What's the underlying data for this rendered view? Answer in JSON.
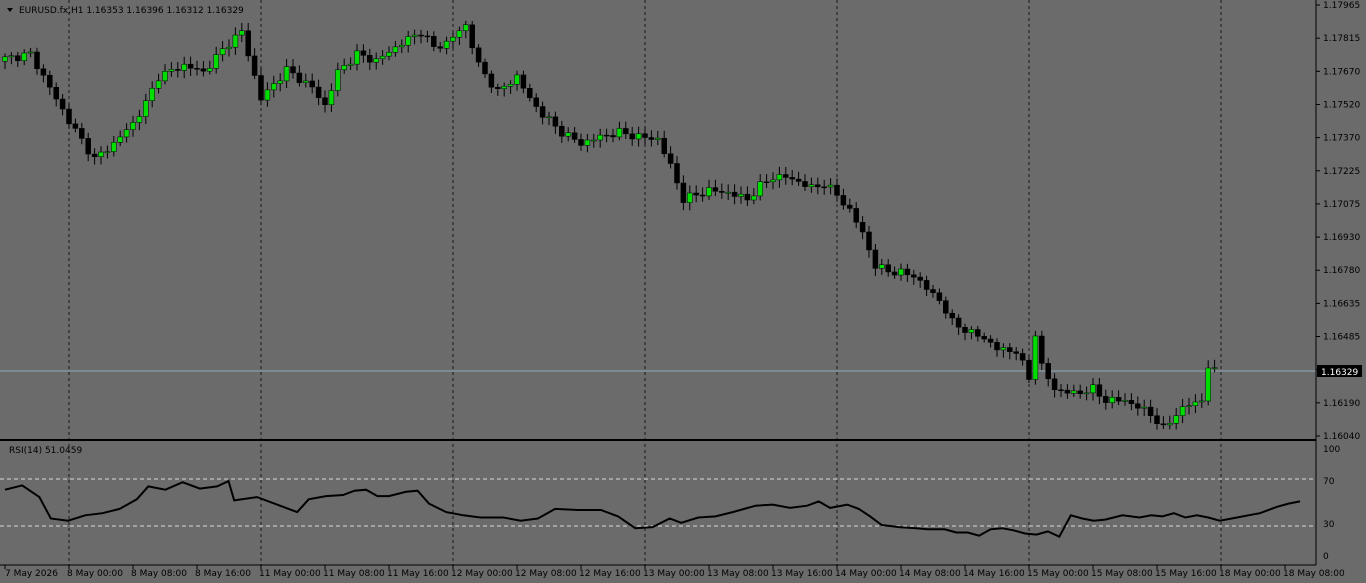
{
  "header": {
    "symbol_line": "EURUSD.fx,H1  1.16353 1.16396 1.16312 1.16329"
  },
  "indicator": {
    "label": "RSI(14) 51.0459",
    "levels": [
      "100",
      "70",
      "30",
      "0"
    ]
  },
  "colors": {
    "background": "#6b6b6b",
    "bull_candle": "#00dd00",
    "bear_candle": "#000000",
    "grid_separator": "#1a1a1a",
    "price_line": "#8fa8b8",
    "rsi_line": "#000000",
    "rsi_levels": "#d9d9d9"
  },
  "chart_data": [
    {
      "type": "candlestick",
      "symbol": "EURUSD.fx",
      "timeframe": "H1",
      "current_price": "1.16329",
      "ylim": [
        1.1604,
        1.1797
      ],
      "price_ticks": [
        "1.17965",
        "1.17815",
        "1.17670",
        "1.17520",
        "1.17370",
        "1.17225",
        "1.17075",
        "1.16930",
        "1.16780",
        "1.16635",
        "1.16485",
        "1.16335",
        "1.16190",
        "1.16040"
      ],
      "time_labels": [
        "7 May 2026",
        "8 May 00:00",
        "8 May 08:00",
        "8 May 16:00",
        "11 May 00:00",
        "11 May 08:00",
        "11 May 16:00",
        "12 May 00:00",
        "12 May 08:00",
        "12 May 16:00",
        "13 May 00:00",
        "13 May 08:00",
        "13 May 16:00",
        "14 May 00:00",
        "14 May 08:00",
        "14 May 16:00",
        "15 May 00:00",
        "15 May 08:00",
        "15 May 16:00",
        "18 May 00:00",
        "18 May 08:00"
      ],
      "close_path": [
        [
          0,
          1.1773
        ],
        [
          4,
          1.1775
        ],
        [
          8,
          1.1755
        ],
        [
          10,
          1.1745
        ],
        [
          14,
          1.1728
        ],
        [
          17,
          1.1735
        ],
        [
          20,
          1.1744
        ],
        [
          22,
          1.1753
        ],
        [
          24,
          1.1765
        ],
        [
          28,
          1.177
        ],
        [
          31,
          1.1767
        ],
        [
          35,
          1.178
        ],
        [
          37,
          1.1785
        ],
        [
          40,
          1.1755
        ],
        [
          44,
          1.1768
        ],
        [
          48,
          1.176
        ],
        [
          50,
          1.1752
        ],
        [
          52,
          1.1767
        ],
        [
          55,
          1.1775
        ],
        [
          58,
          1.1772
        ],
        [
          62,
          1.178
        ],
        [
          65,
          1.1785
        ],
        [
          67,
          1.1778
        ],
        [
          69,
          1.178
        ],
        [
          72,
          1.1788
        ],
        [
          74,
          1.177
        ],
        [
          77,
          1.1758
        ],
        [
          80,
          1.1765
        ],
        [
          82,
          1.1755
        ],
        [
          84,
          1.1748
        ],
        [
          87,
          1.174
        ],
        [
          90,
          1.1735
        ],
        [
          93,
          1.1738
        ],
        [
          96,
          1.174
        ],
        [
          99,
          1.1738
        ],
        [
          102,
          1.1737
        ],
        [
          104,
          1.1725
        ],
        [
          106,
          1.171
        ],
        [
          110,
          1.1714
        ],
        [
          113,
          1.1713
        ],
        [
          116,
          1.171
        ],
        [
          118,
          1.1716
        ],
        [
          120,
          1.172
        ],
        [
          122,
          1.172
        ],
        [
          124,
          1.1718
        ],
        [
          126,
          1.1715
        ],
        [
          128,
          1.1717
        ],
        [
          130,
          1.1712
        ],
        [
          132,
          1.1705
        ],
        [
          134,
          1.1695
        ],
        [
          136,
          1.168
        ],
        [
          138,
          1.1678
        ],
        [
          140,
          1.1677
        ],
        [
          142,
          1.1676
        ],
        [
          144,
          1.167
        ],
        [
          146,
          1.1665
        ],
        [
          148,
          1.1655
        ],
        [
          151,
          1.165
        ],
        [
          153,
          1.1648
        ],
        [
          155,
          1.1643
        ],
        [
          158,
          1.1642
        ],
        [
          160,
          1.163
        ],
        [
          161,
          1.165
        ],
        [
          162,
          1.1635
        ],
        [
          164,
          1.1625
        ],
        [
          167,
          1.1623
        ],
        [
          170,
          1.1625
        ],
        [
          172,
          1.162
        ],
        [
          175,
          1.162
        ],
        [
          177,
          1.1617
        ],
        [
          179,
          1.1614
        ],
        [
          181,
          1.1607
        ],
        [
          183,
          1.1614
        ],
        [
          185,
          1.1618
        ],
        [
          187,
          1.162
        ],
        [
          188,
          1.1635
        ],
        [
          189,
          1.1633
        ]
      ]
    },
    {
      "type": "line",
      "name": "RSI(14)",
      "ylim": [
        0,
        100
      ],
      "levels": [
        30,
        70
      ],
      "last_value": "51.0459",
      "points": [
        [
          0,
          62
        ],
        [
          3,
          66
        ],
        [
          6,
          55
        ],
        [
          8,
          35
        ],
        [
          11,
          33
        ],
        [
          14,
          38
        ],
        [
          17,
          40
        ],
        [
          20,
          44
        ],
        [
          23,
          53
        ],
        [
          25,
          65
        ],
        [
          28,
          62
        ],
        [
          31,
          69
        ],
        [
          34,
          63
        ],
        [
          37,
          65
        ],
        [
          39,
          70
        ],
        [
          40,
          52
        ],
        [
          44,
          55
        ],
        [
          48,
          47
        ],
        [
          51,
          41
        ],
        [
          53,
          53
        ],
        [
          56,
          56
        ],
        [
          59,
          57
        ],
        [
          61,
          61
        ],
        [
          63,
          62
        ],
        [
          65,
          56
        ],
        [
          67,
          56
        ],
        [
          70,
          60
        ],
        [
          72,
          61
        ],
        [
          74,
          49
        ],
        [
          77,
          41
        ],
        [
          80,
          38
        ],
        [
          83,
          36
        ],
        [
          85,
          36
        ],
        [
          87,
          36
        ],
        [
          90,
          33
        ],
        [
          93,
          35
        ],
        [
          96,
          44
        ],
        [
          100,
          43
        ],
        [
          104,
          43
        ],
        [
          107,
          37
        ],
        [
          110,
          26
        ],
        [
          113,
          27
        ],
        [
          116,
          35
        ],
        [
          118,
          31
        ],
        [
          121,
          36
        ],
        [
          124,
          37
        ],
        [
          127,
          41
        ],
        [
          129,
          44
        ],
        [
          131,
          47
        ],
        [
          134,
          48
        ],
        [
          137,
          45
        ],
        [
          140,
          47
        ],
        [
          142,
          51
        ],
        [
          144,
          45
        ],
        [
          147,
          48
        ],
        [
          149,
          44
        ],
        [
          151,
          37
        ],
        [
          153,
          29
        ],
        [
          156,
          27
        ],
        [
          159,
          26
        ],
        [
          161,
          25
        ],
        [
          164,
          25
        ],
        [
          166,
          22
        ],
        [
          168,
          22
        ],
        [
          170,
          19
        ],
        [
          172,
          25
        ],
        [
          174,
          26
        ],
        [
          176,
          24
        ],
        [
          178,
          21
        ],
        [
          180,
          20
        ],
        [
          182,
          23
        ],
        [
          184,
          18
        ],
        [
          186,
          38
        ],
        [
          188,
          35
        ],
        [
          190,
          33
        ],
        [
          192,
          34
        ],
        [
          195,
          38
        ],
        [
          198,
          36
        ],
        [
          200,
          38
        ],
        [
          202,
          37
        ],
        [
          204,
          40
        ],
        [
          206,
          36
        ],
        [
          208,
          38
        ],
        [
          210,
          36
        ],
        [
          212,
          33
        ],
        [
          215,
          36
        ],
        [
          217,
          38
        ],
        [
          219,
          40
        ],
        [
          222,
          46
        ],
        [
          224,
          49
        ],
        [
          226,
          51
        ]
      ]
    }
  ]
}
